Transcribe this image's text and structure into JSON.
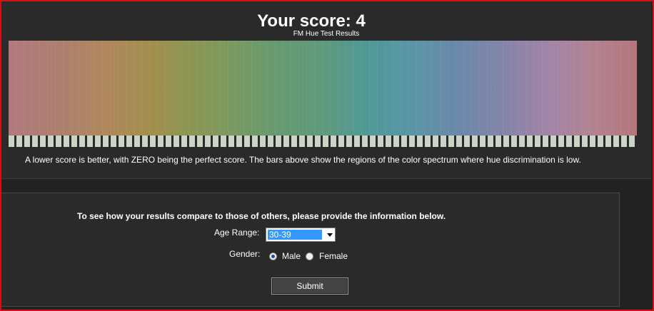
{
  "results": {
    "score_title": "Your score: 4",
    "subtitle": "FM Hue Test Results",
    "explanation": "A lower score is better, with ZERO being the perfect score. The bars above show the regions of the color spectrum where hue discrimination is low."
  },
  "spectrum": {
    "bar_count": 80,
    "tick_count": 80,
    "tick_color": "#cbd5c6"
  },
  "compare": {
    "prompt": "To see how your results compare to those of others, please provide the information below.",
    "age_label": "Age Range:",
    "age_value": "30-39",
    "gender_label": "Gender:",
    "male_label": "Male",
    "female_label": "Female",
    "selected_gender": "Male",
    "submit_label": "Submit"
  },
  "colors": {
    "background": "#222222",
    "panel": "#2a2a2a",
    "frame": "#d41010",
    "select_highlight": "#3399ff"
  }
}
